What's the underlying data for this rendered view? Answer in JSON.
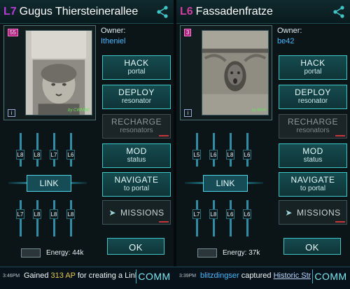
{
  "colors": {
    "level_l7": "#b43fd6",
    "level_l6": "#d13fa0",
    "accent": "#3fc7c7",
    "owner": "#46b8ff"
  },
  "icons": {
    "share": "share-icon",
    "key": "key-icon",
    "info": "info-icon",
    "missions": "missions-arrow-icon"
  },
  "panels": [
    {
      "level": "L7",
      "title": "Gugus Thiersteinerallee",
      "badge": "55",
      "info": "i",
      "credit": "by CWMBE",
      "owner_label": "Owner:",
      "owner_name": "Itheniel",
      "buttons": {
        "hack": {
          "l1": "HACK",
          "l2": "portal"
        },
        "deploy": {
          "l1": "DEPLOY",
          "l2": "resonator"
        },
        "recharge": {
          "l1": "RECHARGE",
          "l2": "resonators"
        },
        "mod": {
          "l1": "MOD",
          "l2": "status"
        },
        "navigate": {
          "l1": "NAVIGATE",
          "l2": "to portal"
        },
        "missions": {
          "l1": "MISSIONS",
          "icon": "➤"
        },
        "ok": {
          "l1": "OK"
        }
      },
      "link": "LINK",
      "resonators_top": [
        "L8",
        "L8",
        "L7",
        "L6"
      ],
      "resonators_bottom": [
        "L7",
        "L8",
        "L8",
        "L8"
      ],
      "energy": "Energy: 44k"
    },
    {
      "level": "L6",
      "title": "Fassadenfratze",
      "badge": "3",
      "info": "i",
      "credit": "by MH4",
      "owner_label": "Owner:",
      "owner_name": "be42",
      "buttons": {
        "hack": {
          "l1": "HACK",
          "l2": "portal"
        },
        "deploy": {
          "l1": "DEPLOY",
          "l2": "resonator"
        },
        "recharge": {
          "l1": "RECHARGE",
          "l2": "resonators"
        },
        "mod": {
          "l1": "MOD",
          "l2": "status"
        },
        "navigate": {
          "l1": "NAVIGATE",
          "l2": "to portal"
        },
        "missions": {
          "l1": "MISSIONS",
          "icon": "➤"
        },
        "ok": {
          "l1": "OK"
        }
      },
      "link": "LINK",
      "resonators_top": [
        "L5",
        "L6",
        "L8",
        "L6"
      ],
      "resonators_bottom": [
        "L7",
        "L8",
        "L6",
        "L6"
      ],
      "energy": "Energy: 37k"
    }
  ],
  "comm": {
    "left": {
      "time": "3:46PM",
      "msg_pre": "Gained ",
      "ap": "313 AP",
      "msg_post": " for creating a Link",
      "btn": "COMM"
    },
    "right": {
      "time": "3:39PM",
      "player": "blitzdingser",
      "verb": " captured ",
      "portal": "Historic Str",
      "btn": "COMM"
    }
  }
}
